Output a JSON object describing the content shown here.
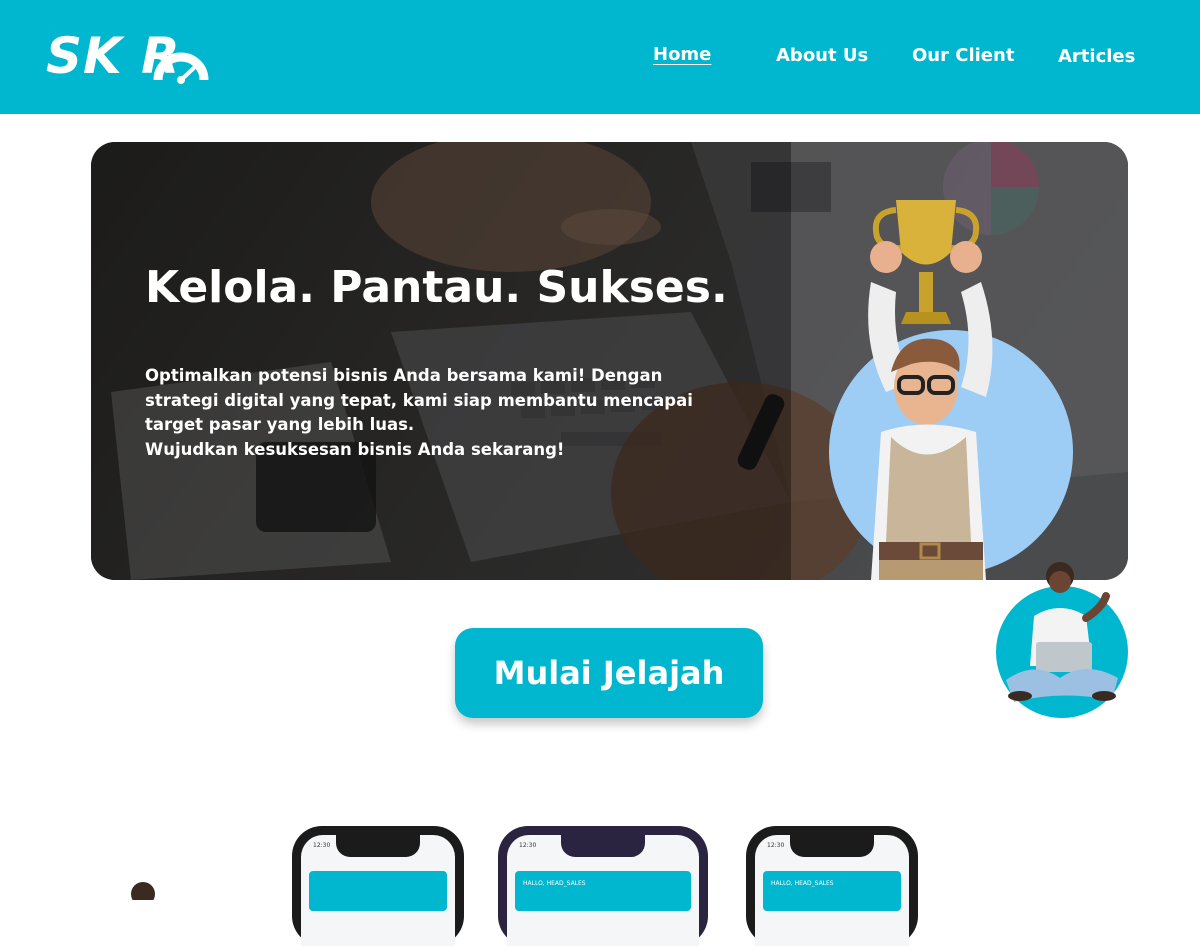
{
  "brand": {
    "name": "SK  R",
    "logo_alt": "SKOR"
  },
  "nav": {
    "items": [
      {
        "label": "Home",
        "active": true
      },
      {
        "label": "About Us",
        "active": false
      },
      {
        "label": "Our Client",
        "active": false
      },
      {
        "label": "Articles",
        "active": false
      }
    ]
  },
  "hero": {
    "title": "Kelola. Pantau. Sukses.",
    "description_lines": [
      "Optimalkan potensi bisnis Anda bersama kami! Dengan",
      "strategi digital yang tepat, kami siap membantu mencapai",
      "target pasar yang lebih luas.",
      "Wujudkan kesuksesan bisnis Anda sekarang!"
    ]
  },
  "cta": {
    "label": "Mulai Jelajah"
  },
  "phones": [
    {
      "time": "12:30",
      "greeting": ""
    },
    {
      "time": "12:30",
      "greeting": "HALLO, HEAD_SALES"
    },
    {
      "time": "12:30",
      "greeting": "HALLO, HEAD_SALES"
    }
  ],
  "colors": {
    "primary": "#00b7cf",
    "white": "#ffffff"
  },
  "icons": {
    "logo_gauge": "speedometer-icon",
    "chat": "support-agent-icon"
  }
}
